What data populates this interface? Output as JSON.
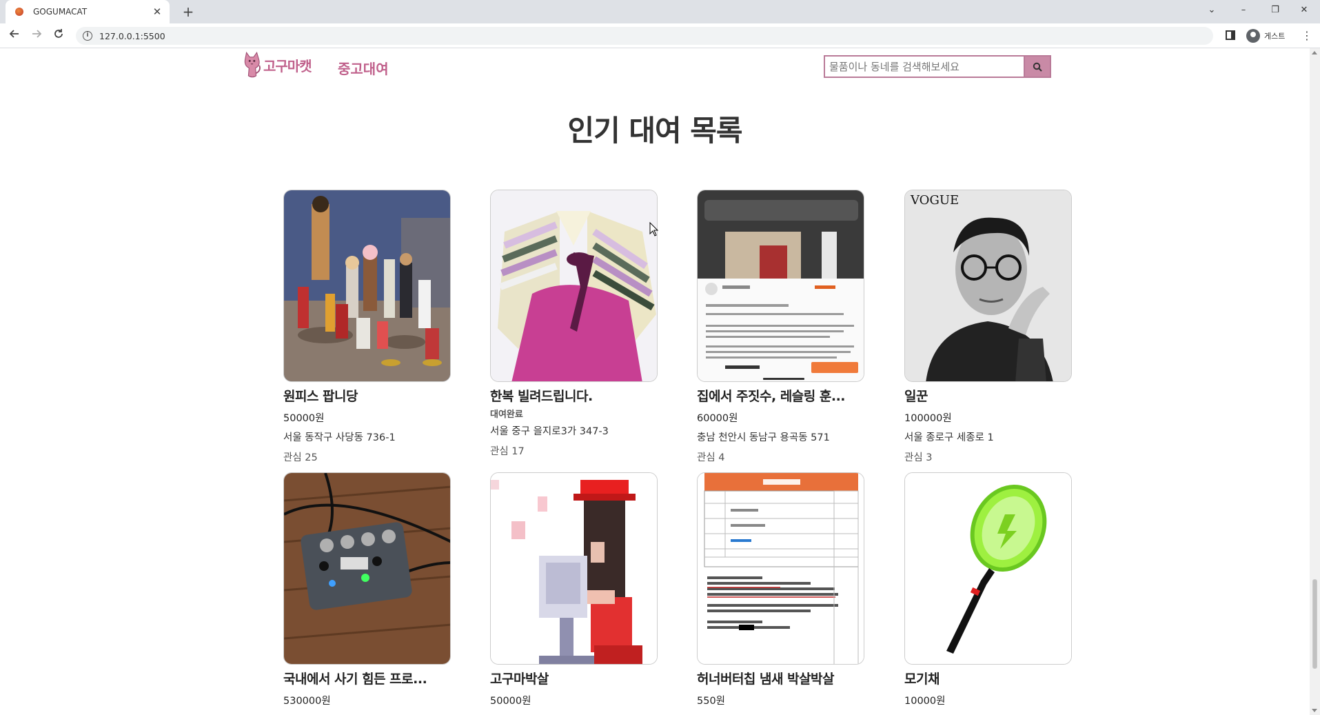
{
  "browser": {
    "tab_title": "GOGUMACAT",
    "url": "127.0.0.1:5500",
    "profile_label": "게스트"
  },
  "header": {
    "logo_text": "고구마캣",
    "nav_used": "중고대여",
    "search_placeholder": "물품이나 동네를 검색해보세요"
  },
  "main": {
    "title": "인기 대여 목록"
  },
  "items": [
    {
      "name": "원피스 팝니당",
      "price": "50000원",
      "status": "",
      "address": "서울 동작구 사당동 736-1",
      "likes": "관심 25",
      "image": "figure-collection"
    },
    {
      "name": "한복 빌려드립니다.",
      "price": "",
      "status": "대여완료",
      "address": "서울 중구 을지로3가 347-3",
      "likes": "관심 17",
      "image": "hanbok"
    },
    {
      "name": "집에서 주짓수, 레슬링 훈...",
      "price": "60000원",
      "status": "",
      "address": "충남 천안시 동남구 용곡동 571",
      "likes": "관심 4",
      "image": "app-screenshot"
    },
    {
      "name": "일꾼",
      "price": "100000원",
      "status": "",
      "address": "서울 종로구 세종로 1",
      "likes": "관심 3",
      "image": "vogue-portrait"
    },
    {
      "name": "국내에서 사기 힘든 프로...",
      "price": "530000원",
      "status": "",
      "address": "",
      "likes": "",
      "image": "guitar-pedal"
    },
    {
      "name": "고구마박살",
      "price": "50000원",
      "status": "",
      "address": "",
      "likes": "",
      "image": "pixel-art"
    },
    {
      "name": "허너버터칩 냄새 박살박살",
      "price": "550원",
      "status": "",
      "address": "",
      "likes": "",
      "image": "listing-screenshot"
    },
    {
      "name": "모기채",
      "price": "10000원",
      "status": "",
      "address": "",
      "likes": "",
      "image": "bug-zapper"
    }
  ],
  "colors": {
    "brand": "#c0608b",
    "search_border": "#b97a98",
    "search_button": "#c98aa6"
  },
  "icons": [
    "back-arrow-icon",
    "forward-arrow-icon",
    "reload-icon",
    "info-icon",
    "search-icon",
    "close-icon",
    "plus-icon"
  ]
}
